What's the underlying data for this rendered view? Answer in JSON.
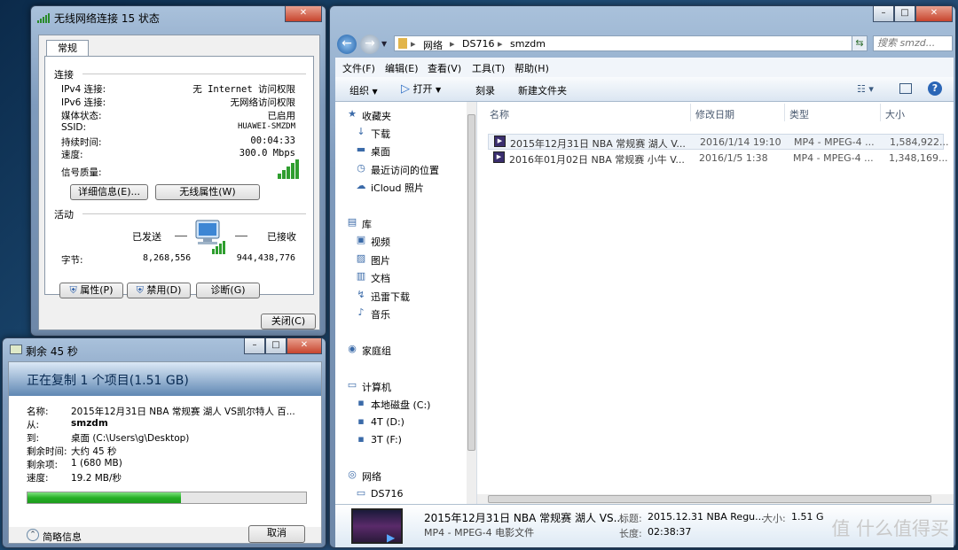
{
  "status_dialog": {
    "title": "无线网络连接 15 状态",
    "tab": "常规",
    "section_connection": "连接",
    "rows": [
      {
        "label": "IPv4 连接:",
        "value": "无 Internet 访问权限"
      },
      {
        "label": "IPv6 连接:",
        "value": "无网络访问权限"
      },
      {
        "label": "媒体状态:",
        "value": "已启用"
      },
      {
        "label": "SSID:",
        "value": "HUAWEI-SMZDM"
      },
      {
        "label": "持续时间:",
        "value": "00:04:33"
      },
      {
        "label": "速度:",
        "value": "300.0 Mbps"
      }
    ],
    "signal_label": "信号质量:",
    "details_button": "详细信息(E)...",
    "wireless_props_button": "无线属性(W)",
    "section_activity": "活动",
    "sent_label": "已发送",
    "received_label": "已接收",
    "bytes_label": "字节:",
    "bytes_sent": "8,268,556",
    "bytes_received": "944,438,776",
    "properties_button": "属性(P)",
    "disable_button": "禁用(D)",
    "diagnose_button": "诊断(G)",
    "close_button": "关闭(C)"
  },
  "copy_dialog": {
    "title": "剩余 45 秒",
    "header": "正在复制 1 个项目(1.51 GB)",
    "fields": [
      {
        "key": "名称:",
        "value": "2015年12月31日 NBA 常规赛 湖人     VS凯尔特人 百..."
      },
      {
        "key": "从:",
        "value": "smzdm"
      },
      {
        "key": "到:",
        "value": "桌面 (C:\\Users\\g\\Desktop)"
      },
      {
        "key": "剩余时间:",
        "value": "大约 45 秒"
      },
      {
        "key": "剩余项:",
        "value": "1 (680 MB)"
      },
      {
        "key": "速度:",
        "value": "19.2 MB/秒"
      }
    ],
    "progress_fraction": 0.55,
    "brief_info": "简略信息",
    "cancel_button": "取消"
  },
  "explorer": {
    "breadcrumb": [
      "网络",
      "DS716",
      "smzdm"
    ],
    "search_placeholder": "搜索 smzd...",
    "menu": [
      "文件(F)",
      "编辑(E)",
      "查看(V)",
      "工具(T)",
      "帮助(H)"
    ],
    "toolbar": {
      "organize": "组织",
      "play": "打开",
      "burn": "刻录",
      "new_folder": "新建文件夹"
    },
    "nav": [
      {
        "label": "收藏夹",
        "icon": "★"
      },
      {
        "label": "下载",
        "icon": "↓"
      },
      {
        "label": "桌面",
        "icon": "▬"
      },
      {
        "label": "最近访问的位置",
        "icon": "◷"
      },
      {
        "label": "iCloud 照片",
        "icon": "☁"
      },
      {
        "label": "库",
        "icon": "▤"
      },
      {
        "label": "视频",
        "icon": "▣"
      },
      {
        "label": "图片",
        "icon": "▨"
      },
      {
        "label": "文档",
        "icon": "▥"
      },
      {
        "label": "迅雷下载",
        "icon": "↯"
      },
      {
        "label": "音乐",
        "icon": "♪"
      },
      {
        "label": "家庭组",
        "icon": "◉"
      },
      {
        "label": "计算机",
        "icon": "▭"
      },
      {
        "label": "本地磁盘 (C:)",
        "icon": "▪"
      },
      {
        "label": "4T (D:)",
        "icon": "▪"
      },
      {
        "label": "3T (F:)",
        "icon": "▪"
      },
      {
        "label": "网络",
        "icon": "◎"
      },
      {
        "label": "DS716",
        "icon": "▭"
      }
    ],
    "columns": [
      "名称",
      "修改日期",
      "类型",
      "大小"
    ],
    "files": [
      {
        "name": "2015年12月31日 NBA 常规赛 湖人     V...",
        "date": "2016/1/14 19:10",
        "type": "MP4 - MPEG-4 ...",
        "size": "1,584,922..."
      },
      {
        "name": "2016年01月02日 NBA 常规赛 小牛     V...",
        "date": "2016/1/5 1:38",
        "type": "MP4 - MPEG-4 ...",
        "size": "1,348,169..."
      }
    ],
    "details": {
      "name": "2015年12月31日 NBA 常规赛 湖人     VS...",
      "type": "MP4 - MPEG-4 电影文件",
      "title_label": "标题:",
      "title_value": "2015.12.31 NBA Regu...",
      "duration_label": "长度:",
      "duration_value": "02:38:37",
      "size_label": "大小:",
      "size_value": "1.51 G"
    }
  },
  "watermark": "值 什么值得买"
}
